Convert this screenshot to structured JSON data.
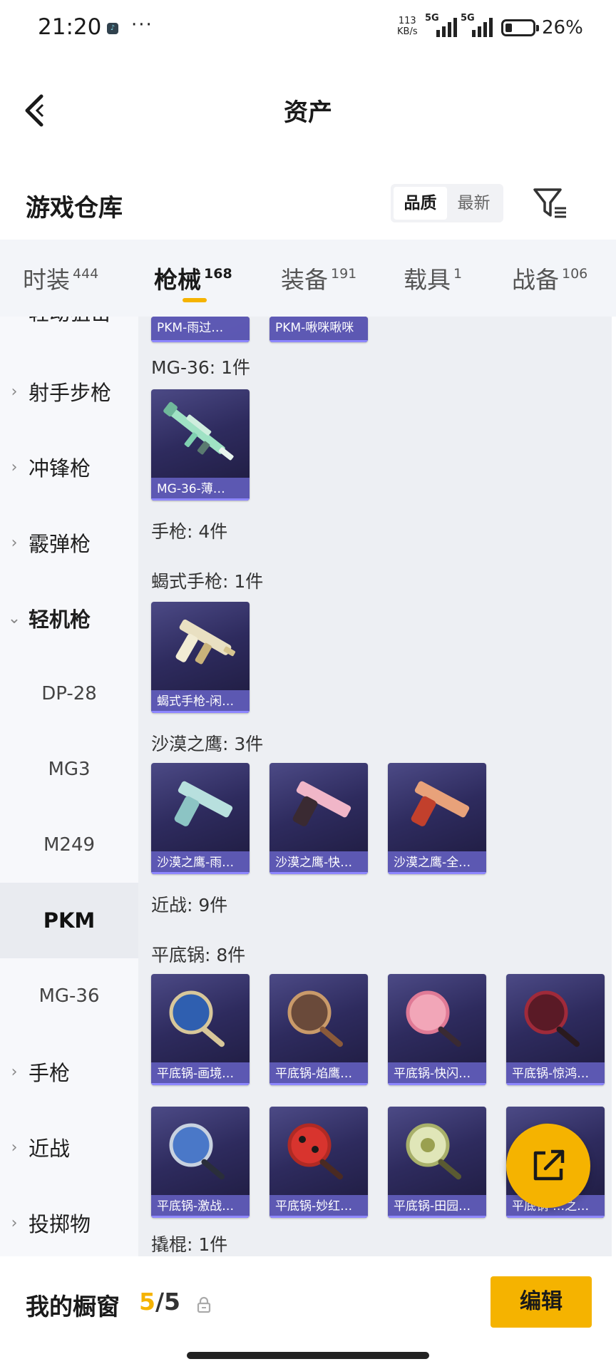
{
  "status_bar": {
    "time": "21:20",
    "app_icon": "tiktok-icon",
    "more": "···",
    "net_speed_value": "113",
    "net_speed_unit": "KB/s",
    "sim1": "5G",
    "sim2": "5G",
    "battery": "26%"
  },
  "header": {
    "title": "资产",
    "back_icon": "chevron-left-icon"
  },
  "warehouse": {
    "title": "游戏仓库",
    "sort_options": [
      "品质",
      "最新"
    ],
    "sort_selected": "品质",
    "filter_icon": "filter-icon"
  },
  "tabs": [
    {
      "label": "时装",
      "count": "444"
    },
    {
      "label": "枪械",
      "count": "168",
      "active": true
    },
    {
      "label": "装备",
      "count": "191"
    },
    {
      "label": "载具",
      "count": "1"
    },
    {
      "label": "战备",
      "count": "106"
    }
  ],
  "sidebar": [
    {
      "label": "轻动狙击",
      "type": "category"
    },
    {
      "label": "射手步枪",
      "type": "category"
    },
    {
      "label": "冲锋枪",
      "type": "category"
    },
    {
      "label": "霰弹枪",
      "type": "category"
    },
    {
      "label": "轻机枪",
      "type": "category",
      "expanded": true
    },
    {
      "label": "DP-28",
      "type": "sub"
    },
    {
      "label": "MG3",
      "type": "sub"
    },
    {
      "label": "M249",
      "type": "sub"
    },
    {
      "label": "PKM",
      "type": "sub",
      "selected": true
    },
    {
      "label": "MG-36",
      "type": "sub"
    },
    {
      "label": "手枪",
      "type": "category"
    },
    {
      "label": "近战",
      "type": "category"
    },
    {
      "label": "投掷物",
      "type": "category"
    }
  ],
  "content": {
    "partial_cards": [
      "PKM-雨过…",
      "PKM-啾咪啾咪"
    ],
    "mg36_label": "MG-36: 1件",
    "mg36_cards": [
      "MG-36-薄…"
    ],
    "pistol_label": "手枪: 4件",
    "scorpion_label": "蝎式手枪: 1件",
    "scorpion_cards": [
      "蝎式手枪-闲…"
    ],
    "deagle_label": "沙漠之鹰: 3件",
    "deagle_cards": [
      "沙漠之鹰-雨…",
      "沙漠之鹰-快…",
      "沙漠之鹰-全…"
    ],
    "melee_label": "近战: 9件",
    "pan_label": "平底锅: 8件",
    "pan_cards_row1": [
      "平底锅-画境…",
      "平底锅-焰鹰…",
      "平底锅-快闪…",
      "平底锅-惊鸿…"
    ],
    "pan_cards_row2": [
      "平底锅-激战…",
      "平底锅-妙红…",
      "平底锅-田园…",
      "平底锅-…之…"
    ],
    "crowbar_label": "撬棍: 1件"
  },
  "bottom": {
    "title": "我的橱窗",
    "count_current": "5",
    "count_sep": "/",
    "count_total": "5",
    "edit_label": "编辑",
    "share_icon": "share-out-icon"
  }
}
